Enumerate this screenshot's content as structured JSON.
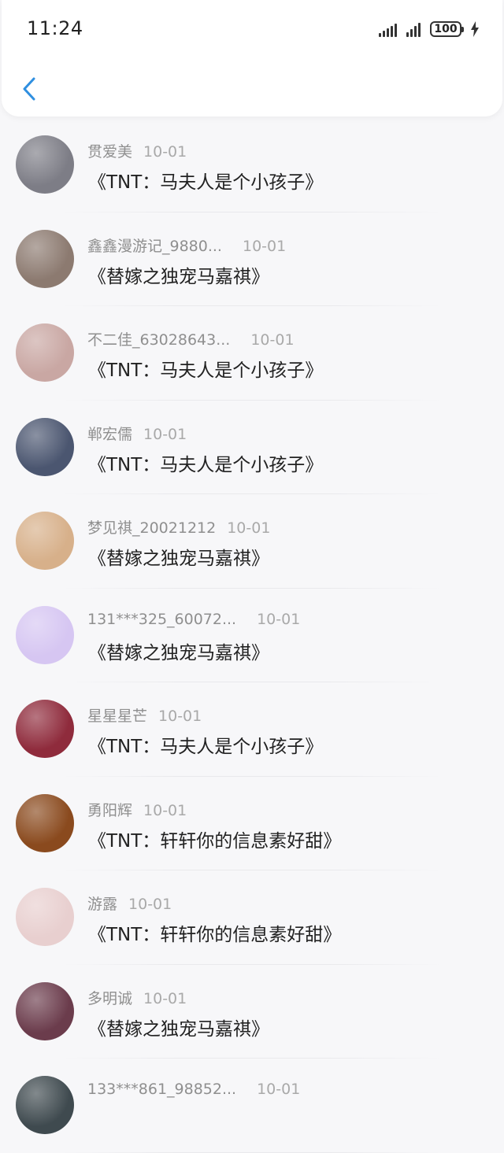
{
  "status_bar": {
    "time": "11:24",
    "battery": "100"
  },
  "items": [
    {
      "name": "贯爱美",
      "date": "10-01",
      "title": "《TNT：马夫人是个小孩子》",
      "avatar_color": "#7d7d86"
    },
    {
      "name": "鑫鑫漫游记_9880...",
      "date": "10-01",
      "title": "《替嫁之独宠马嘉祺》",
      "avatar_color": "#8c7a70"
    },
    {
      "name": "不二佳_63028643...",
      "date": "10-01",
      "title": "《TNT：马夫人是个小孩子》",
      "avatar_color": "#c9a7a3"
    },
    {
      "name": "郸宏儒",
      "date": "10-01",
      "title": "《TNT：马夫人是个小孩子》",
      "avatar_color": "#4b5670"
    },
    {
      "name": "梦见祺_20021212",
      "date": "10-01",
      "title": "《替嫁之独宠马嘉祺》",
      "avatar_color": "#d7b08a"
    },
    {
      "name": "131***325_60072...",
      "date": "10-01",
      "title": "《替嫁之独宠马嘉祺》",
      "avatar_color": "#d6c6f2"
    },
    {
      "name": "星星星芒",
      "date": "10-01",
      "title": "《TNT：马夫人是个小孩子》",
      "avatar_color": "#8f2b3c"
    },
    {
      "name": "勇阳辉",
      "date": "10-01",
      "title": "《TNT：轩轩你的信息素好甜》",
      "avatar_color": "#8a4a1e"
    },
    {
      "name": "游露",
      "date": "10-01",
      "title": "《TNT：轩轩你的信息素好甜》",
      "avatar_color": "#e8cfcf"
    },
    {
      "name": "多明诚",
      "date": "10-01",
      "title": "《替嫁之独宠马嘉祺》",
      "avatar_color": "#6b3c4c"
    },
    {
      "name": "133***861_98852...",
      "date": "10-01",
      "title": "",
      "avatar_color": "#3f4a4f"
    }
  ]
}
